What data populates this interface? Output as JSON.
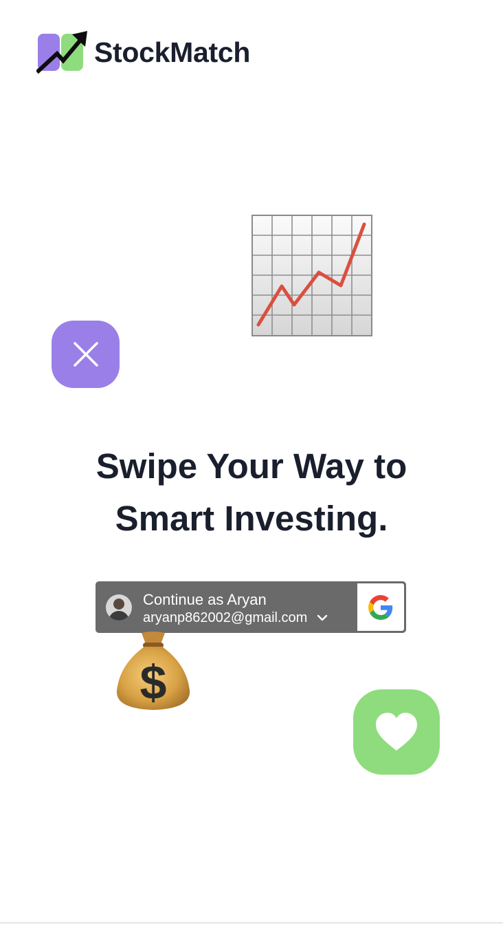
{
  "app": {
    "brand_name": "StockMatch",
    "logo_icon": "stockmatch-logo-icon"
  },
  "hero": {
    "headline_line1": "Swipe Your Way to",
    "headline_line2": "Smart Investing.",
    "decor_chart_icon": "chart-increasing-emoji",
    "decor_money_icon": "money-bag-emoji"
  },
  "actions": {
    "reject_icon": "close-icon",
    "like_icon": "heart-icon"
  },
  "google_signin": {
    "title": "Continue as Aryan",
    "email": "aryanp862002@gmail.com",
    "avatar_icon": "avatar",
    "dropdown_icon": "chevron-down-icon",
    "provider_icon": "google-g-icon"
  },
  "colors": {
    "brand_purple": "#9b7fe8",
    "brand_green": "#8fdc7e",
    "text_dark": "#1a1f2e",
    "google_button_bg": "#6a6a6a"
  }
}
